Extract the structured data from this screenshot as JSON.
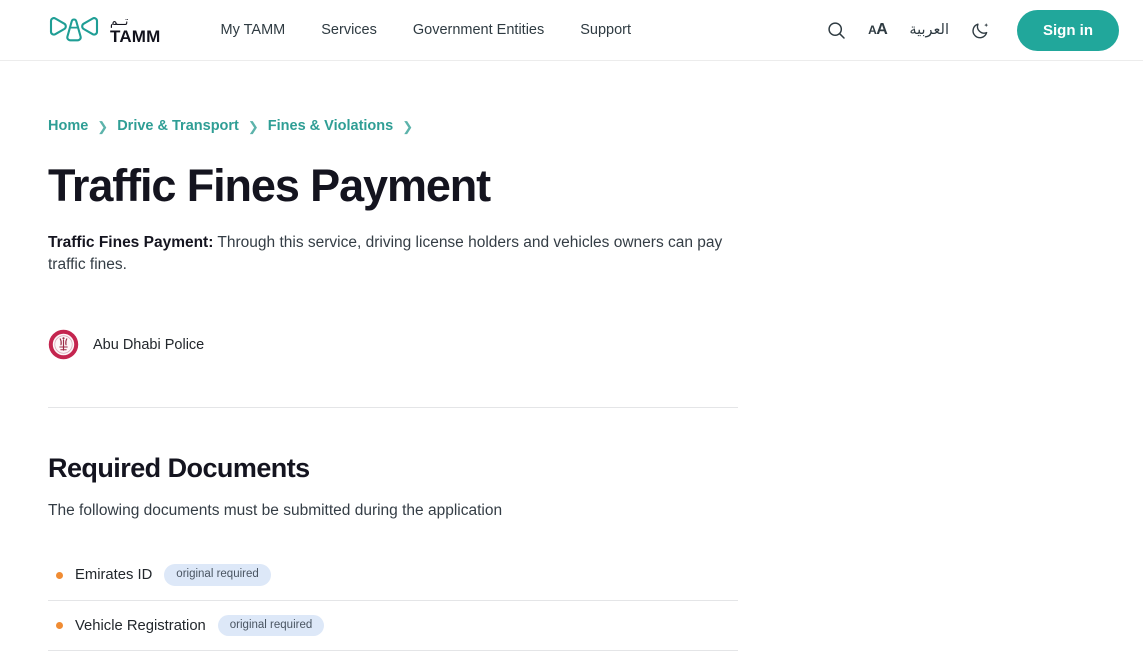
{
  "header": {
    "logo": {
      "arabic": "تــم",
      "latin": "TAMM",
      "icon": "tamm-wings-logo"
    },
    "nav": [
      {
        "label": "My TAMM"
      },
      {
        "label": "Services"
      },
      {
        "label": "Government Entities"
      },
      {
        "label": "Support"
      }
    ],
    "actions": {
      "search_icon": "search-icon",
      "text_size_large": "A",
      "text_size_small": "A",
      "language_label": "العربية",
      "dark_mode_icon": "moon-icon",
      "signin_label": "Sign in"
    },
    "colors": {
      "brand_teal": "#21A79B",
      "link_teal": "#2f9e95"
    }
  },
  "breadcrumb": {
    "items": [
      {
        "label": "Home"
      },
      {
        "label": "Drive & Transport"
      },
      {
        "label": "Fines & Violations"
      }
    ],
    "separator": "❯",
    "trailing_separator": "❯"
  },
  "main": {
    "title": "Traffic Fines Payment",
    "description_lead": "Traffic Fines Payment:",
    "description_body": " Through this service, driving license holders and vehicles owners can pay traffic fines.",
    "entity": {
      "name": "Abu Dhabi Police",
      "logo_icon": "abu-dhabi-police-emblem",
      "logo_color": "#C4254F"
    }
  },
  "required_documents": {
    "heading": "Required Documents",
    "subtitle": "The following documents must be submitted during the application",
    "badge_color": "#DDE8F8",
    "bullet_color": "#F08C33",
    "items": [
      {
        "label": "Emirates ID",
        "badge": "original required"
      },
      {
        "label": "Vehicle Registration",
        "badge": "original required"
      }
    ]
  }
}
